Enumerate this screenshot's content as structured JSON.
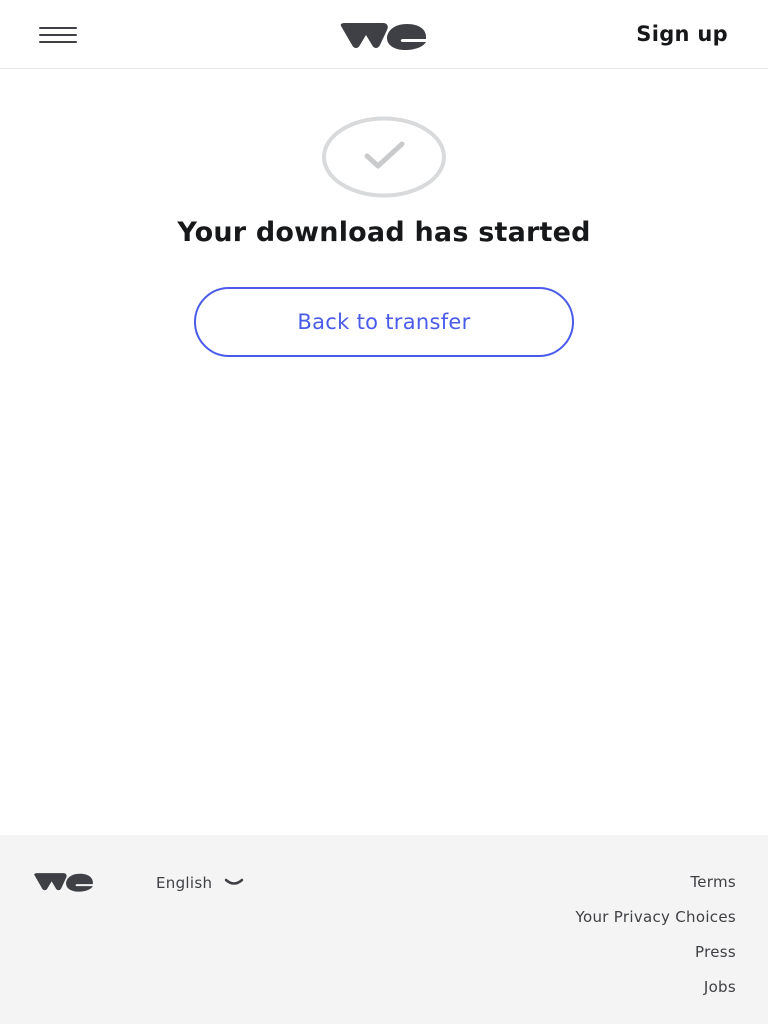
{
  "header": {
    "menu_icon": "hamburger-menu-icon",
    "logo": "wetransfer-we-logo",
    "signup_label": "Sign up"
  },
  "main": {
    "status_icon": "check-circle-icon",
    "title": "Your download has started",
    "back_button_label": "Back to transfer"
  },
  "footer": {
    "logo": "wetransfer-we-logo",
    "language": "English",
    "language_icon": "chevron-down-icon",
    "links": [
      "Terms",
      "Your Privacy Choices",
      "Press",
      "Jobs"
    ]
  },
  "colors": {
    "accent": "#4a5bea",
    "text": "#17181a",
    "muted": "#3f4045",
    "circle": "#d9dadc",
    "footer_bg": "#f4f4f4"
  }
}
